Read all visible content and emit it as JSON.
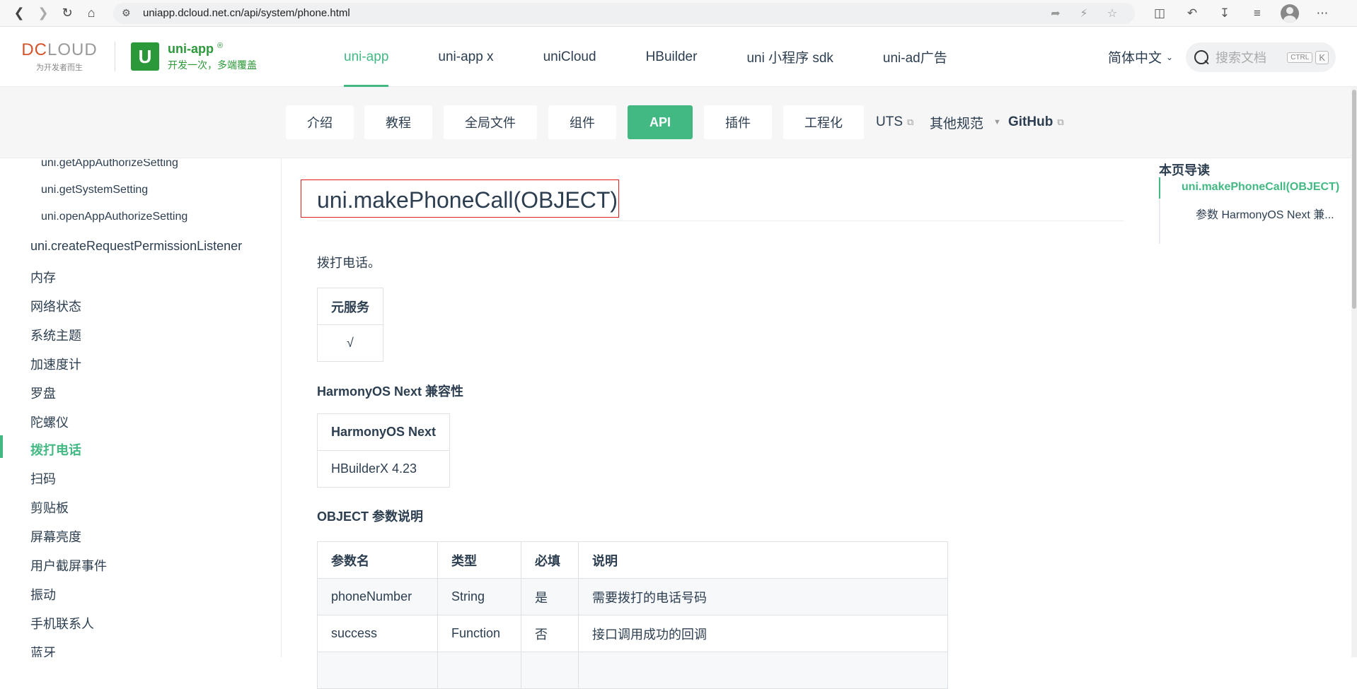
{
  "browser": {
    "url": "uniapp.dcloud.net.cn/api/system/phone.html"
  },
  "header": {
    "dc_logo_left": "DC",
    "dc_logo_right": "LOUD",
    "dc_tagline": "为开发者而生",
    "uni_mark": "U",
    "uni_title": "uni-app",
    "uni_reg": "®",
    "uni_slogan": "开发一次，多端覆盖",
    "nav": [
      "uni-app",
      "uni-app x",
      "uniCloud",
      "HBuilder",
      "uni 小程序 sdk",
      "uni-ad广告"
    ],
    "lang": "简体中文",
    "search_placeholder": "搜索文档",
    "kbd_ctrl": "CTRL",
    "kbd_k": "K"
  },
  "subnav": {
    "pills": [
      "介绍",
      "教程",
      "全局文件",
      "组件",
      "API",
      "插件",
      "工程化"
    ],
    "uts": "UTS",
    "other": "其他规范",
    "github": "GitHub"
  },
  "sidebar": {
    "sub_items": [
      "uni.getAppAuthorizeSetting",
      "uni.getSystemSetting",
      "uni.openAppAuthorizeSetting"
    ],
    "items": [
      "uni.createRequestPermissionListener",
      "内存",
      "网络状态",
      "系统主题",
      "加速度计",
      "罗盘",
      "陀螺仪",
      "拨打电话",
      "扫码",
      "剪贴板",
      "屏幕亮度",
      "用户截屏事件",
      "振动",
      "手机联系人",
      "蓝牙"
    ],
    "active_index": 7
  },
  "main": {
    "title": "uni.makePhoneCall(OBJECT)",
    "desc": "拨打电话。",
    "svc_header": "元服务",
    "svc_value": "√",
    "harmony_heading": "HarmonyOS Next 兼容性",
    "harmony_header": "HarmonyOS Next",
    "harmony_value": "HBuilderX 4.23",
    "params_heading": "OBJECT 参数说明",
    "params_headers": [
      "参数名",
      "类型",
      "必填",
      "说明"
    ],
    "params_rows": [
      [
        "phoneNumber",
        "String",
        "是",
        "需要拨打的电话号码"
      ],
      [
        "success",
        "Function",
        "否",
        "接口调用成功的回调"
      ]
    ]
  },
  "toc": {
    "title": "本页导读",
    "items": [
      "uni.makePhoneCall(OBJECT)",
      "参数 HarmonyOS Next 兼..."
    ]
  },
  "colors": {
    "accent": "#42b983",
    "brand_green": "#2b9939",
    "highlight_box": "#e02020"
  }
}
